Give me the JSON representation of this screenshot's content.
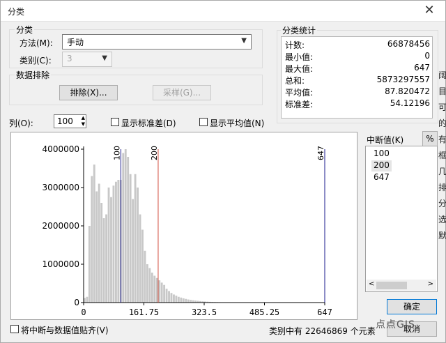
{
  "dialog": {
    "title": "分类",
    "close_glyph": "✕",
    "classification": {
      "group_label": "分类",
      "method_label": "方法(M):",
      "method_value": "手动",
      "classes_label": "类别(C):",
      "classes_value": "3"
    },
    "exclusion": {
      "group_label": "数据排除",
      "exclude_btn": "排除(X)...",
      "sample_btn": "采样(G)..."
    },
    "stats": {
      "group_label": "分类统计",
      "rows": [
        {
          "k": "计数:",
          "v": "66878456"
        },
        {
          "k": "最小值:",
          "v": "0"
        },
        {
          "k": "最大值:",
          "v": "647"
        },
        {
          "k": "总和:",
          "v": "5873297557"
        },
        {
          "k": "平均值:",
          "v": "87.820472"
        },
        {
          "k": "标准差:",
          "v": "54.12196"
        }
      ]
    },
    "columns_label": "列(O):",
    "columns_value": "100",
    "show_std_label": "显示标准差(D)",
    "show_mean_label": "显示平均值(N)",
    "breaks": {
      "label": "中断值(K)",
      "percent_btn": "%",
      "items": [
        "100",
        "200",
        "647"
      ],
      "selected_index": 1
    },
    "ok_btn": "确定",
    "cancel_btn": "取消",
    "snap_label": "将中断与数据值贴齐(V)",
    "status_text": "类别中有 22646869 个元素",
    "watermark": "点点GIS",
    "right_strip": [
      "阔",
      "目",
      "可",
      "的",
      "有",
      "框",
      "几",
      "",
      "排",
      "分",
      "选",
      "默",
      "",
      "排"
    ]
  },
  "chart_data": {
    "type": "bar",
    "title": "",
    "xlabel": "",
    "ylabel": "",
    "xlim": [
      0,
      647
    ],
    "ylim": [
      0,
      4000000
    ],
    "xticks": [
      "0",
      "161.75",
      "323.5",
      "485.25",
      "647"
    ],
    "yticks": [
      "0",
      "1000000",
      "2000000",
      "3000000",
      "4000000"
    ],
    "bar_color": "#c8c8c8",
    "bin_width": 6.47,
    "values": [
      120000,
      150000,
      2000000,
      3300000,
      3600000,
      2900000,
      3100000,
      2600000,
      2200000,
      2300000,
      3000000,
      2750000,
      3050000,
      3150000,
      3200000,
      3200000,
      3900000,
      4000000,
      3800000,
      3350000,
      2700000,
      3350000,
      3000000,
      2300000,
      1900000,
      1350000,
      1000000,
      900000,
      780000,
      700000,
      640000,
      580000,
      520000,
      460000,
      360000,
      300000,
      250000,
      210000,
      180000,
      150000,
      130000,
      110000,
      95000,
      80000,
      70000,
      60000,
      52000,
      45000,
      38000,
      33000,
      28000,
      24000,
      20000,
      17000,
      14000,
      12000,
      10000,
      8000,
      7000,
      6000,
      5000,
      4200,
      3500,
      3000,
      2600,
      2200,
      1800,
      1500,
      1300,
      1100,
      900,
      750,
      600,
      500,
      400,
      330,
      270,
      220,
      180,
      150,
      120,
      100,
      80,
      60,
      50,
      40,
      30,
      25,
      20,
      15,
      12,
      10,
      8,
      6,
      5,
      4,
      3,
      2,
      1,
      1
    ],
    "break_lines": [
      {
        "value": 100,
        "label": "100",
        "color": "#1a1a8c"
      },
      {
        "value": 200,
        "label": "200",
        "color": "#d04a3a"
      },
      {
        "value": 647,
        "label": "647",
        "color": "#1a1a8c"
      }
    ]
  }
}
